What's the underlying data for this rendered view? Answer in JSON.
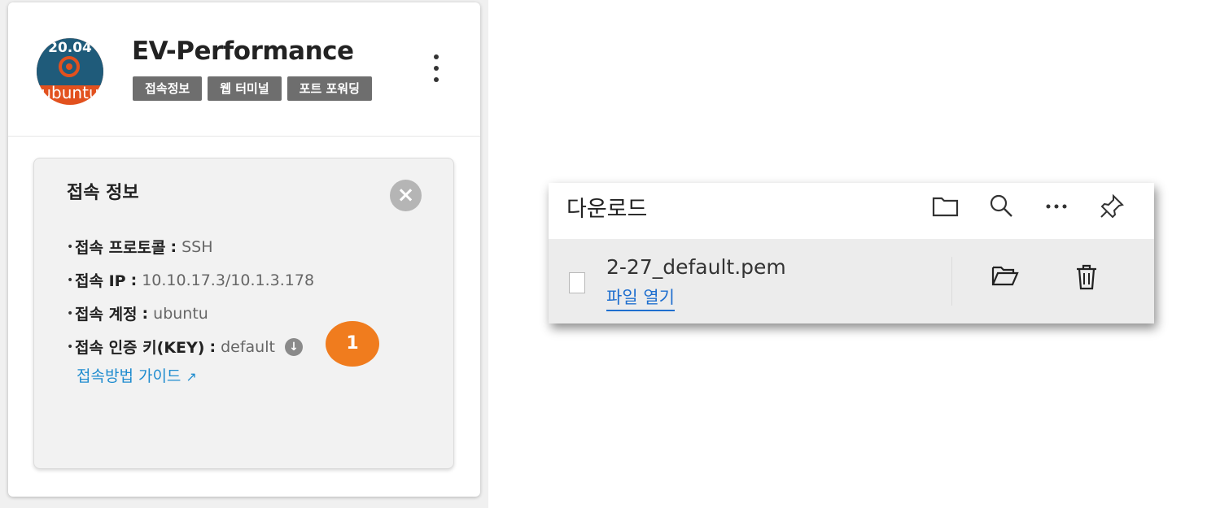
{
  "server": {
    "name": "EV-Performance",
    "os_version": "20.04",
    "os_brand": "ubuntu",
    "tabs": [
      "접속정보",
      "웹 터미널",
      "포트 포워딩"
    ]
  },
  "connection_info": {
    "title": "접속 정보",
    "rows": [
      {
        "label": "접속 프로토콜",
        "value": "SSH"
      },
      {
        "label": "접속 IP",
        "value": "10.10.17.3/10.1.3.178"
      },
      {
        "label": "접속 계정",
        "value": "ubuntu"
      },
      {
        "label": "접속 인증 키(KEY)",
        "value": "default"
      }
    ],
    "guide_link": "접속방법 가이드",
    "step_badge": "1"
  },
  "downloads": {
    "title": "다운로드",
    "item": {
      "filename": "2-27_default.pem",
      "open_label": "파일 열기"
    }
  },
  "colors": {
    "accent_orange": "#f07c1e",
    "link_blue": "#1f8ccf",
    "chip_gray": "#6e6e6e"
  }
}
